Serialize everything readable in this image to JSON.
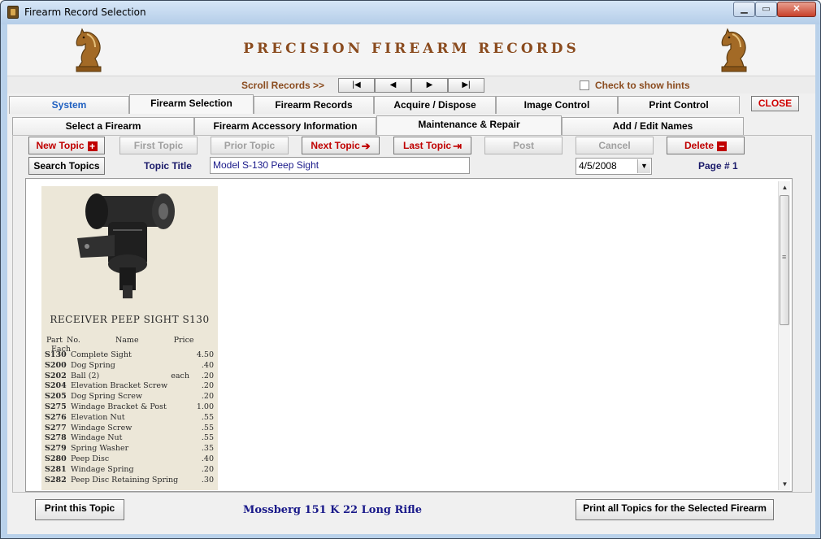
{
  "window": {
    "title": "Firearm Record Selection",
    "min_symbol": "▁",
    "max_symbol": "▭",
    "close_symbol": "✕"
  },
  "header": {
    "banner": "PRECISION FIREARM RECORDS"
  },
  "scroll": {
    "label": "Scroll  Records >>",
    "buttons": [
      {
        "name": "first-record",
        "symbol": "|◀"
      },
      {
        "name": "prior-record",
        "symbol": "◀"
      },
      {
        "name": "next-record",
        "symbol": "▶"
      },
      {
        "name": "last-record",
        "symbol": "▶|"
      }
    ],
    "hint_label": "Check to show hints",
    "hint_checked": false
  },
  "main_tabs": {
    "system": "System",
    "firearm_selection": "Firearm Selection",
    "firearm_records": "Firearm Records",
    "acquire_dispose": "Acquire / Dispose",
    "image_control": "Image Control",
    "print_control": "Print Control",
    "close": "CLOSE"
  },
  "sub_tabs": {
    "select_firearm": "Select a Firearm",
    "accessory_info": "Firearm Accessory Information",
    "maintenance": "Maintenance & Repair",
    "add_edit_names": "Add / Edit Names"
  },
  "toolbar": {
    "new_topic": "New Topic",
    "first_topic": "First Topic",
    "prior_topic": "Prior Topic",
    "next_topic": "Next Topic",
    "last_topic": "Last Topic",
    "post": "Post",
    "cancel": "Cancel",
    "delete": "Delete",
    "search_topics": "Search Topics",
    "topic_title_label": "Topic Title",
    "topic_title_value": "Model S-130 Peep Sight",
    "date_value": "4/5/2008",
    "page_label": "Page #  1"
  },
  "catalog": {
    "title": "RECEIVER PEEP SIGHT S130",
    "head_part": "Part",
    "head_no": "No.",
    "head_name": "Name",
    "head_price": "Price",
    "head_each": "Each",
    "rows": [
      {
        "part": "S130",
        "name": "Complete  Sight",
        "price": "4.50"
      },
      {
        "part": "S200",
        "name": "Dog  Spring",
        "price": ".40"
      },
      {
        "part": "S202",
        "name": "Ball  (2)",
        "extra": "each",
        "price": ".20"
      },
      {
        "part": "S204",
        "name": "Elevation  Bracket  Screw",
        "price": ".20"
      },
      {
        "part": "S205",
        "name": "Dog  Spring  Screw",
        "price": ".20"
      },
      {
        "part": "S275",
        "name": "Windage  Bracket  &  Post",
        "price": "1.00"
      },
      {
        "part": "S276",
        "name": "Elevation   Nut",
        "price": ".55"
      },
      {
        "part": "S277",
        "name": "Windage  Screw",
        "price": ".55"
      },
      {
        "part": "S278",
        "name": "Windage  Nut",
        "price": ".55"
      },
      {
        "part": "S279",
        "name": "Spring  Washer",
        "price": ".35"
      },
      {
        "part": "S280",
        "name": "Peep  Disc",
        "price": ".40"
      },
      {
        "part": "S281",
        "name": "Windage  Spring",
        "price": ".20"
      },
      {
        "part": "S282",
        "name": "Peep  Disc  Retaining  Spring",
        "price": ".30"
      }
    ]
  },
  "footer": {
    "print_topic": "Print this Topic",
    "firearm_name": "Mossberg 151 K  22 Long Rifle",
    "print_all": "Print all Topics for the Selected Firearm"
  },
  "colors": {
    "banner": "#8a4b1e",
    "close_text": "#d00000",
    "accent_red": "#c00000",
    "accent_blue": "#1a1a8a"
  }
}
